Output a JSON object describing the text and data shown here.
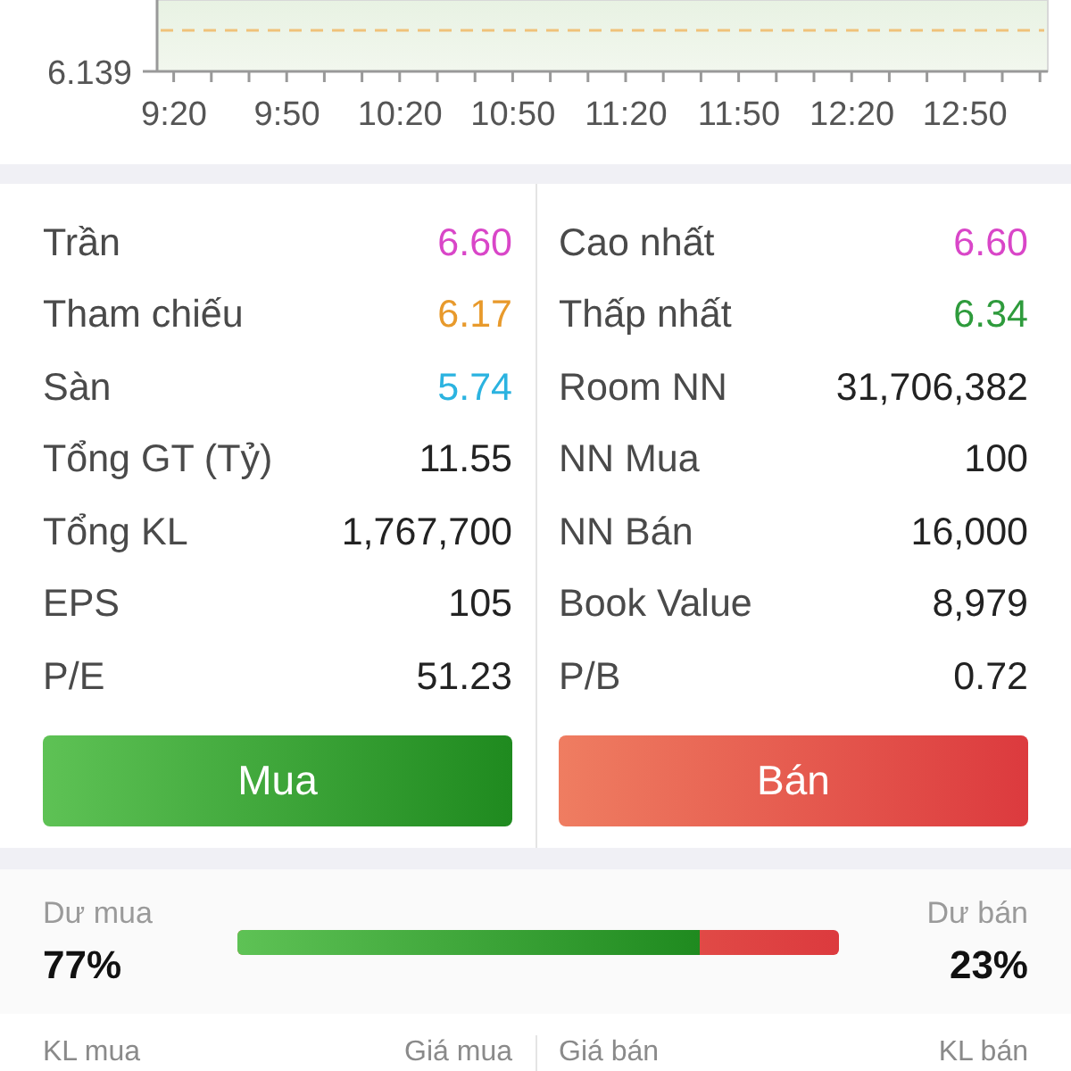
{
  "chart": {
    "y_tick_label": "6.139",
    "x_tick_labels": [
      "9:20",
      "9:50",
      "10:20",
      "10:50",
      "11:20",
      "11:50",
      "12:20",
      "12:50"
    ]
  },
  "stats": {
    "columns": [
      {
        "rows": [
          {
            "label": "Trần",
            "value": "6.60",
            "color": "#d946c8"
          },
          {
            "label": "Tham chiếu",
            "value": "6.17",
            "color": "#e89a2c"
          },
          {
            "label": "Sàn",
            "value": "5.74",
            "color": "#2bb3e0"
          },
          {
            "label": "Tổng GT (Tỷ)",
            "value": "11.55",
            "color": "#222222"
          },
          {
            "label": "Tổng KL",
            "value": "1,767,700",
            "color": "#222222"
          },
          {
            "label": "EPS",
            "value": "105",
            "color": "#222222"
          },
          {
            "label": "P/E",
            "value": "51.23",
            "color": "#222222"
          }
        ],
        "button": {
          "label": "Mua",
          "kind": "buy"
        }
      },
      {
        "rows": [
          {
            "label": "Cao nhất",
            "value": "6.60",
            "color": "#d946c8"
          },
          {
            "label": "Thấp nhất",
            "value": "6.34",
            "color": "#2e9b3c"
          },
          {
            "label": "Room NN",
            "value": "31,706,382",
            "color": "#222222"
          },
          {
            "label": "NN Mua",
            "value": "100",
            "color": "#222222"
          },
          {
            "label": "NN Bán",
            "value": "16,000",
            "color": "#222222"
          },
          {
            "label": "Book Value",
            "value": "8,979",
            "color": "#222222"
          },
          {
            "label": "P/B",
            "value": "0.72",
            "color": "#222222"
          }
        ],
        "button": {
          "label": "Bán",
          "kind": "sell"
        }
      }
    ]
  },
  "order_balance": {
    "buy_label": "Dư mua",
    "buy_percent": "77%",
    "sell_label": "Dư bán",
    "sell_percent": "23%",
    "level": 0.77
  },
  "order_book": {
    "columns": [
      "KL mua",
      "Giá mua",
      "Giá bán",
      "KL bán"
    ]
  }
}
